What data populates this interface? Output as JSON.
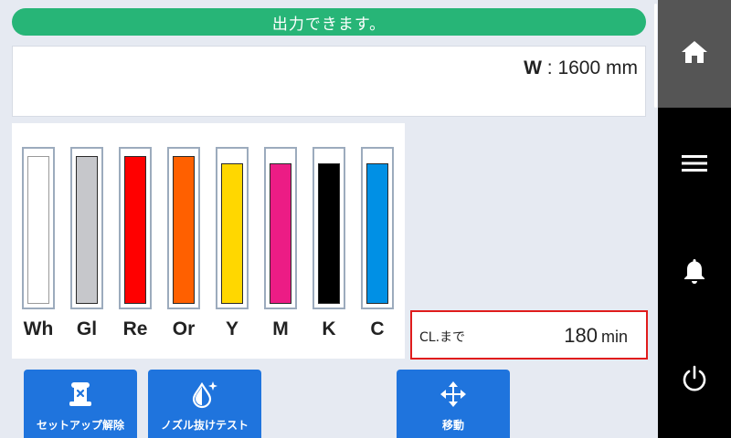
{
  "status": {
    "message": "出力できます。",
    "color": "#27b577"
  },
  "media_width": {
    "label": "W",
    "separator": ":",
    "value": "1600",
    "unit": "mm"
  },
  "inks": [
    {
      "label": "Wh",
      "color": "#ffffff",
      "level": 1.0
    },
    {
      "label": "Gl",
      "color": "#c6c7cb",
      "level": 1.0
    },
    {
      "label": "Re",
      "color": "#ff0000",
      "level": 1.0
    },
    {
      "label": "Or",
      "color": "#ff6000",
      "level": 1.0
    },
    {
      "label": "Y",
      "color": "#ffd700",
      "level": 0.95
    },
    {
      "label": "M",
      "color": "#ec1c85",
      "level": 0.95
    },
    {
      "label": "K",
      "color": "#000000",
      "level": 0.95
    },
    {
      "label": "C",
      "color": "#0090e5",
      "level": 0.95
    }
  ],
  "cleaning": {
    "label": "CL.まで",
    "value": "180",
    "unit": "min",
    "highlight_color": "#e01c1c"
  },
  "actions": [
    {
      "label": "セットアップ解除",
      "icon": "setup-release-icon"
    },
    {
      "label": "ノズル抜けテスト",
      "icon": "nozzle-test-icon"
    },
    {
      "label": "移動",
      "icon": "move-arrows-icon"
    }
  ],
  "sidebar": {
    "items": [
      {
        "name": "home",
        "icon": "home-icon",
        "active": true
      },
      {
        "name": "menu",
        "icon": "menu-icon",
        "active": false
      },
      {
        "name": "notifications",
        "icon": "bell-icon",
        "active": false
      },
      {
        "name": "power",
        "icon": "power-icon",
        "active": false
      }
    ]
  },
  "accent_color": "#1f74dd"
}
